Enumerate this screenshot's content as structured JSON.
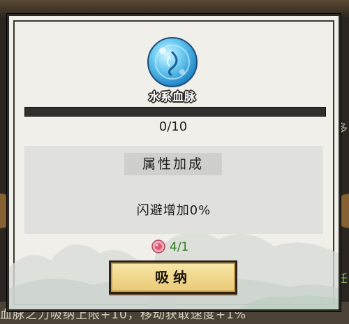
{
  "background": {
    "bottom_text": "血脉之力吸纳上限+10，移动获取速度+1%",
    "right_edge_char_1": "多",
    "right_edge_char_2": "任"
  },
  "bloodline": {
    "name": "水系血脉",
    "icon": "water-orb-icon"
  },
  "progress": {
    "text": "0/10",
    "value": 0,
    "max": 10,
    "fill_color": "#5fc0e8"
  },
  "attributes": {
    "title": "属性加成",
    "bonus_line": "闪避增加0%"
  },
  "cost": {
    "icon": "bloodline-essence-icon",
    "text": "4/1",
    "color": "#2f7c22"
  },
  "absorb_button": {
    "label": "吸纳"
  }
}
